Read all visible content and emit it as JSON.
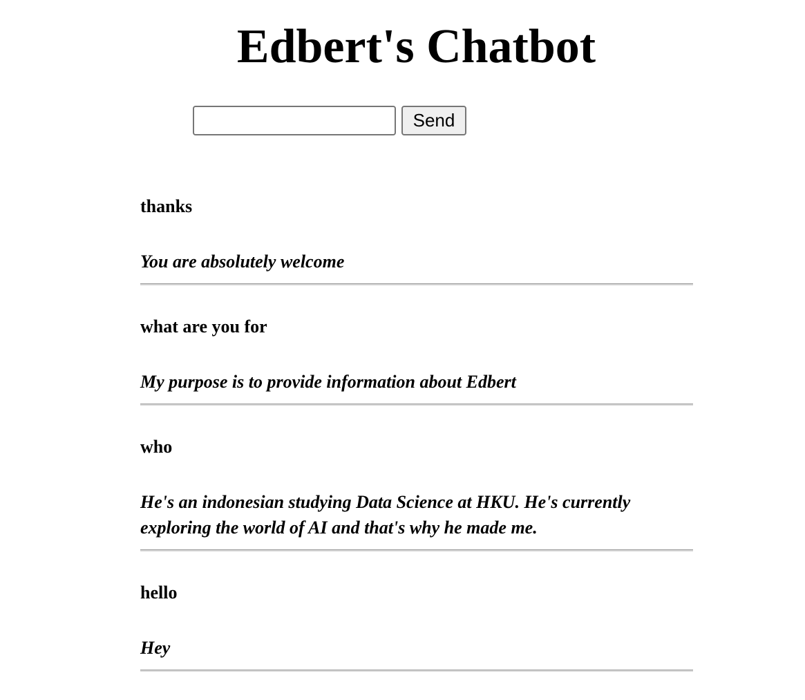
{
  "header": {
    "title": "Edbert's Chatbot"
  },
  "form": {
    "input_value": "",
    "send_label": "Send"
  },
  "conversation": [
    {
      "user": "thanks",
      "bot": "You are absolutely welcome"
    },
    {
      "user": "what are you for",
      "bot": "My purpose is to provide information about Edbert"
    },
    {
      "user": "who",
      "bot": "He's an indonesian studying Data Science at HKU. He's currently exploring the world of AI and that's why he made me."
    },
    {
      "user": "hello",
      "bot": "Hey"
    }
  ]
}
